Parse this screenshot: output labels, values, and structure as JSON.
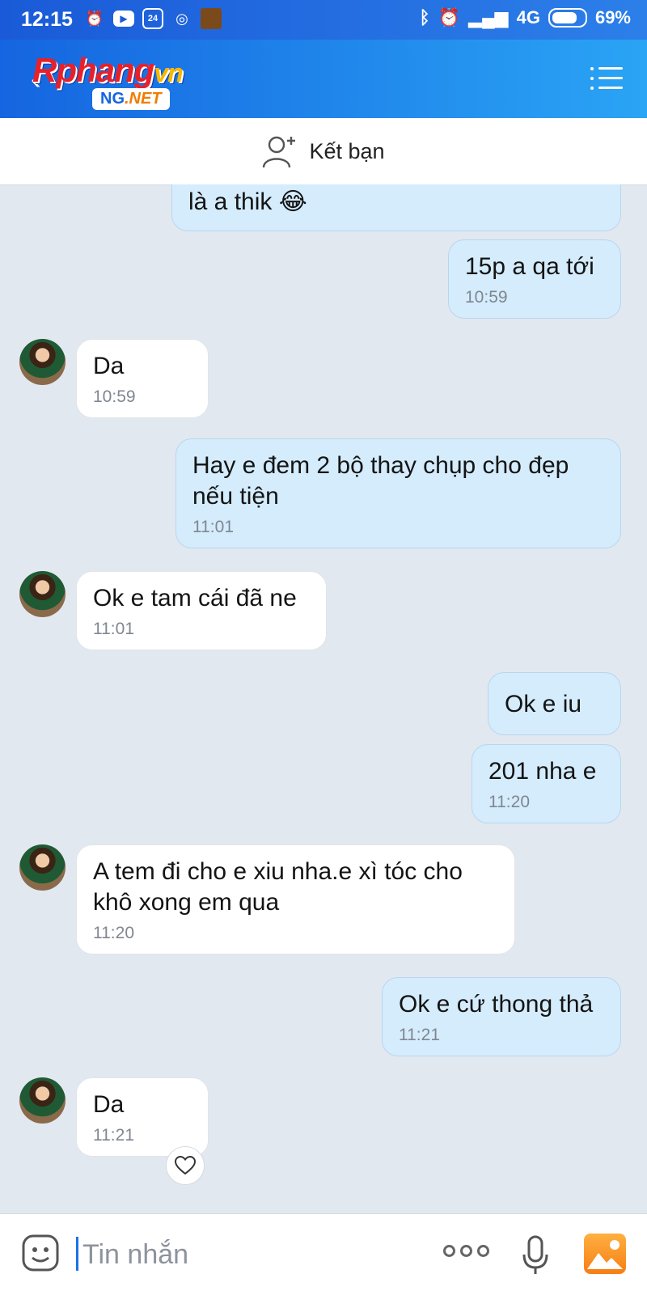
{
  "status_bar": {
    "time": "12:15",
    "network": "4G",
    "battery": "69%",
    "battery_level": 0.69
  },
  "header": {
    "logo_text": "Rphang",
    "logo_suffix": "vn",
    "logo_badge_a": "NG",
    "logo_badge_b": ".NET",
    "icons": [
      "back-arrow-icon",
      "menu-icon"
    ]
  },
  "friend_bar": {
    "label": "Kết bạn",
    "icon": "add-friend-icon"
  },
  "messages": [
    {
      "side": "me",
      "text": "là a thik 😂",
      "time": ""
    },
    {
      "side": "me",
      "text": "15p a qa tới",
      "time": "10:59"
    },
    {
      "side": "them",
      "text": "Da",
      "time": "10:59"
    },
    {
      "side": "me",
      "text": "Hay e đem 2 bộ thay chụp cho đẹp nếu tiện",
      "time": "11:01"
    },
    {
      "side": "them",
      "text": "Ok e tam cái đã ne",
      "time": "11:01"
    },
    {
      "side": "me",
      "text": "Ok e iu",
      "time": ""
    },
    {
      "side": "me",
      "text": "201 nha e",
      "time": "11:20"
    },
    {
      "side": "them",
      "text": "A tem đi cho e xiu nha.e xì tóc cho khô xong em qua",
      "time": "11:20"
    },
    {
      "side": "me",
      "text": "Ok e cứ thong thả",
      "time": "11:21"
    },
    {
      "side": "them",
      "text": "Da",
      "time": "11:21"
    }
  ],
  "input_bar": {
    "placeholder": "Tin nhắn",
    "icons": [
      "sticker-icon",
      "more-icon",
      "microphone-icon",
      "photo-icon"
    ]
  },
  "colors": {
    "header_start": "#1565e0",
    "header_end": "#2aa4f5",
    "my_bubble": "#d4ecfc",
    "their_bubble": "#ffffff",
    "chat_bg": "#e2e8f0"
  }
}
